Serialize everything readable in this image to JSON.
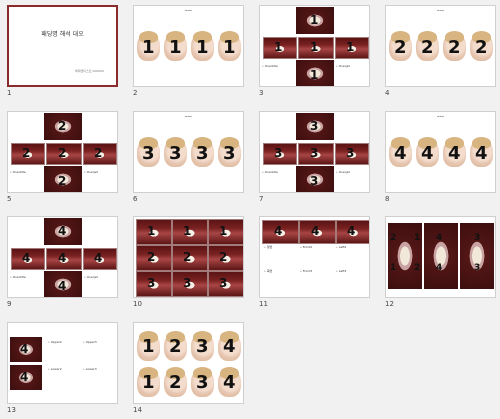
{
  "title_slide": {
    "title": "패딩명 해석 대오",
    "subtitle": "해피덴티스트 000000"
  },
  "slides": [
    {
      "number": "1"
    },
    {
      "number": "2"
    },
    {
      "number": "3"
    },
    {
      "number": "4"
    },
    {
      "number": "5"
    },
    {
      "number": "6"
    },
    {
      "number": "7"
    },
    {
      "number": "8"
    },
    {
      "number": "9"
    },
    {
      "number": "10"
    },
    {
      "number": "11"
    },
    {
      "number": "12"
    },
    {
      "number": "13"
    },
    {
      "number": "14"
    }
  ],
  "labels": {
    "overbite": "• Overbite",
    "overjet": "• Overjet",
    "front2": "• Front2",
    "left2": "• Left2",
    "front3": "• Front3",
    "left3": "• Left3",
    "upper2": "• Upper2",
    "upper3": "• Upper3",
    "lower2": "• Lower2",
    "lower3": "• Lower3",
    "k1": "• 정면",
    "k2": "• 측면"
  },
  "digits": {
    "one": "1",
    "two": "2",
    "three": "3",
    "four": "4"
  },
  "colors": {
    "selected_border": "#8b2a2a",
    "mouth": "#7a2222",
    "background": "#f1f1f1"
  }
}
